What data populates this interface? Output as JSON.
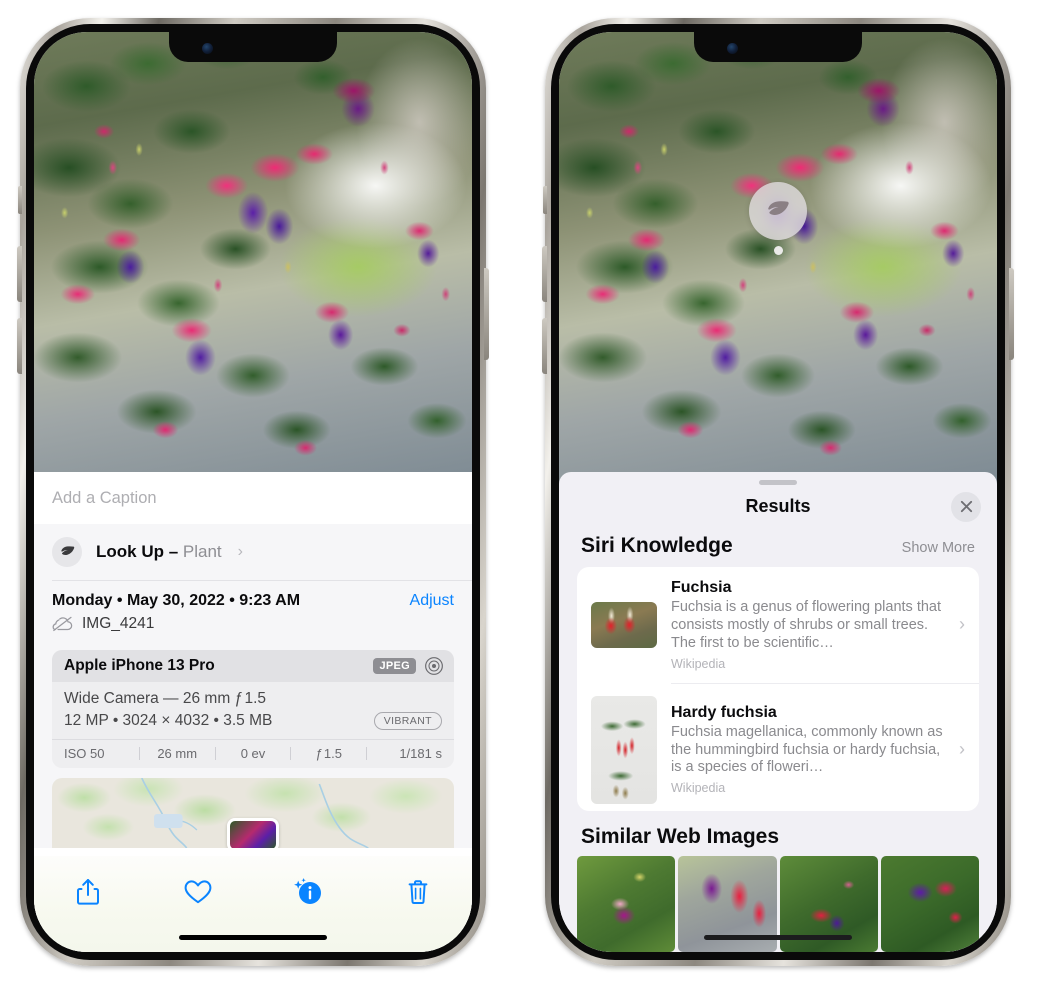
{
  "left_phone": {
    "caption": {
      "placeholder": "Add a Caption",
      "value": ""
    },
    "lookup": {
      "label": "Look Up",
      "dash": " – ",
      "subject": "Plant",
      "chevron": "›",
      "icon": "leaf-icon"
    },
    "meta": {
      "date": "Monday • May 30, 2022 • 9:23 AM",
      "adjust": "Adjust",
      "filename": "IMG_4241",
      "cloud_icon": "cloud-slash-icon"
    },
    "camera": {
      "model": "Apple iPhone 13 Pro",
      "format_tag": "JPEG",
      "aperture_icon": "aperture-icon",
      "lens": "Wide Camera — 26 mm ƒ 1.5",
      "specs": "12 MP • 3024 × 4032 • 3.5 MB",
      "style_pill": "VIBRANT",
      "exif": [
        "ISO 50",
        "26 mm",
        "0 ev",
        "ƒ 1.5",
        "1/181 s"
      ]
    },
    "toolbar": [
      {
        "name": "share-button",
        "icon": "share-icon"
      },
      {
        "name": "favorite-button",
        "icon": "heart-icon"
      },
      {
        "name": "info-button",
        "icon": "info-sparkle-icon"
      },
      {
        "name": "delete-button",
        "icon": "trash-icon"
      }
    ]
  },
  "right_phone": {
    "visual_lookup_badge": {
      "icon": "leaf-icon"
    },
    "sheet": {
      "title": "Results",
      "close_icon": "close-icon",
      "siri_knowledge": {
        "title": "Siri Knowledge",
        "show_more": "Show More",
        "items": [
          {
            "title": "Fuchsia",
            "description": "Fuchsia is a genus of flowering plants that consists mostly of shrubs or small trees. The first to be scientific…",
            "source": "Wikipedia",
            "chevron": "›",
            "thumb": "fuchsia-red-flowers-thumb"
          },
          {
            "title": "Hardy fuchsia",
            "description": "Fuchsia magellanica, commonly known as the hummingbird fuchsia or hardy fuchsia, is a species of floweri…",
            "source": "Wikipedia",
            "chevron": "›",
            "thumb": "hardy-fuchsia-specimen-thumb"
          }
        ]
      },
      "similar_web_images": {
        "title": "Similar Web Images",
        "items": [
          {
            "name": "web-image-1"
          },
          {
            "name": "web-image-2"
          },
          {
            "name": "web-image-3"
          },
          {
            "name": "web-image-4"
          }
        ]
      }
    }
  },
  "colors": {
    "accent_blue": "#0a84ff",
    "sheet_bg": "#f1f0f5",
    "card_bg": "#ffffff",
    "secondary_text": "#8e8e93"
  }
}
